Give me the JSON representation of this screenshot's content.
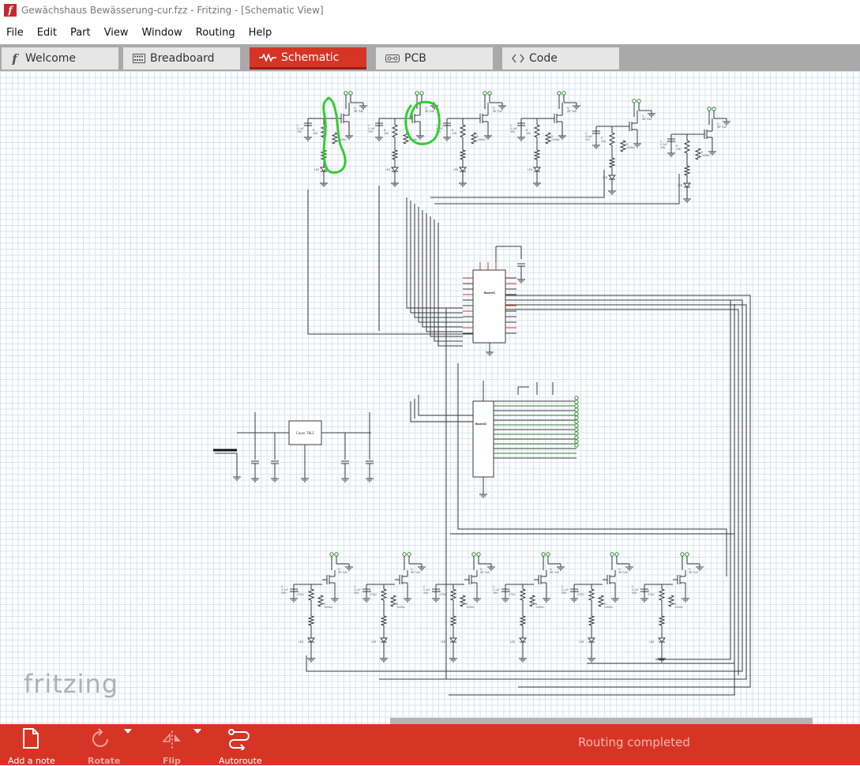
{
  "window": {
    "app_icon_letter": "f",
    "title": "Gewächshaus Bewässerung-cur.fzz - Fritzing - [Schematic View]"
  },
  "menu": [
    "File",
    "Edit",
    "Part",
    "View",
    "Window",
    "Routing",
    "Help"
  ],
  "tabs": [
    {
      "label": "Welcome",
      "icon": "fritzing-f-icon",
      "active": false
    },
    {
      "label": "Breadboard",
      "icon": "breadboard-icon",
      "active": false
    },
    {
      "label": "Schematic",
      "icon": "resistor-zigzag-icon",
      "active": true
    },
    {
      "label": "PCB",
      "icon": "pcb-icon",
      "active": false
    },
    {
      "label": "Code",
      "icon": "code-brackets-icon",
      "active": false
    }
  ],
  "canvas": {
    "watermark": "fritzing",
    "grid_color": "#d9e3ef",
    "wire_color": "#3a3a3a",
    "annotation_color": "#33cc33",
    "chip_labels": {
      "chip1": "Board1",
      "chip2": "Board2",
      "regulator": "Cover 78L1"
    }
  },
  "toolbar": {
    "add_note": "Add a note",
    "rotate": "Rotate",
    "flip": "Flip",
    "autoroute": "Autoroute",
    "status": "Routing completed"
  },
  "colors": {
    "accent": "#d63525",
    "tab_strip": "#a9a9a9",
    "tab_inactive": "#e6e6e6"
  }
}
